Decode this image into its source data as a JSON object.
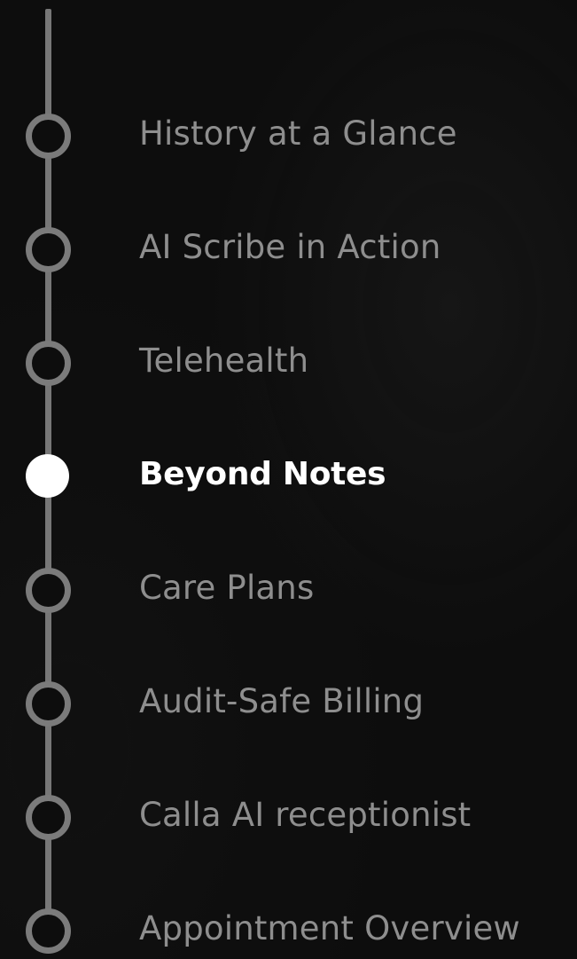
{
  "timeline": {
    "active_index": 3,
    "items": [
      {
        "label": "History at a Glance"
      },
      {
        "label": "AI Scribe in Action"
      },
      {
        "label": "Telehealth"
      },
      {
        "label": "Beyond Notes"
      },
      {
        "label": "Care Plans"
      },
      {
        "label": "Audit-Safe Billing"
      },
      {
        "label": "Calla AI receptionist"
      },
      {
        "label": "Appointment Overview"
      }
    ]
  },
  "colors": {
    "background": "#0d0d0d",
    "line": "#777777",
    "inactive_text": "#8e8e8e",
    "active": "#ffffff"
  }
}
